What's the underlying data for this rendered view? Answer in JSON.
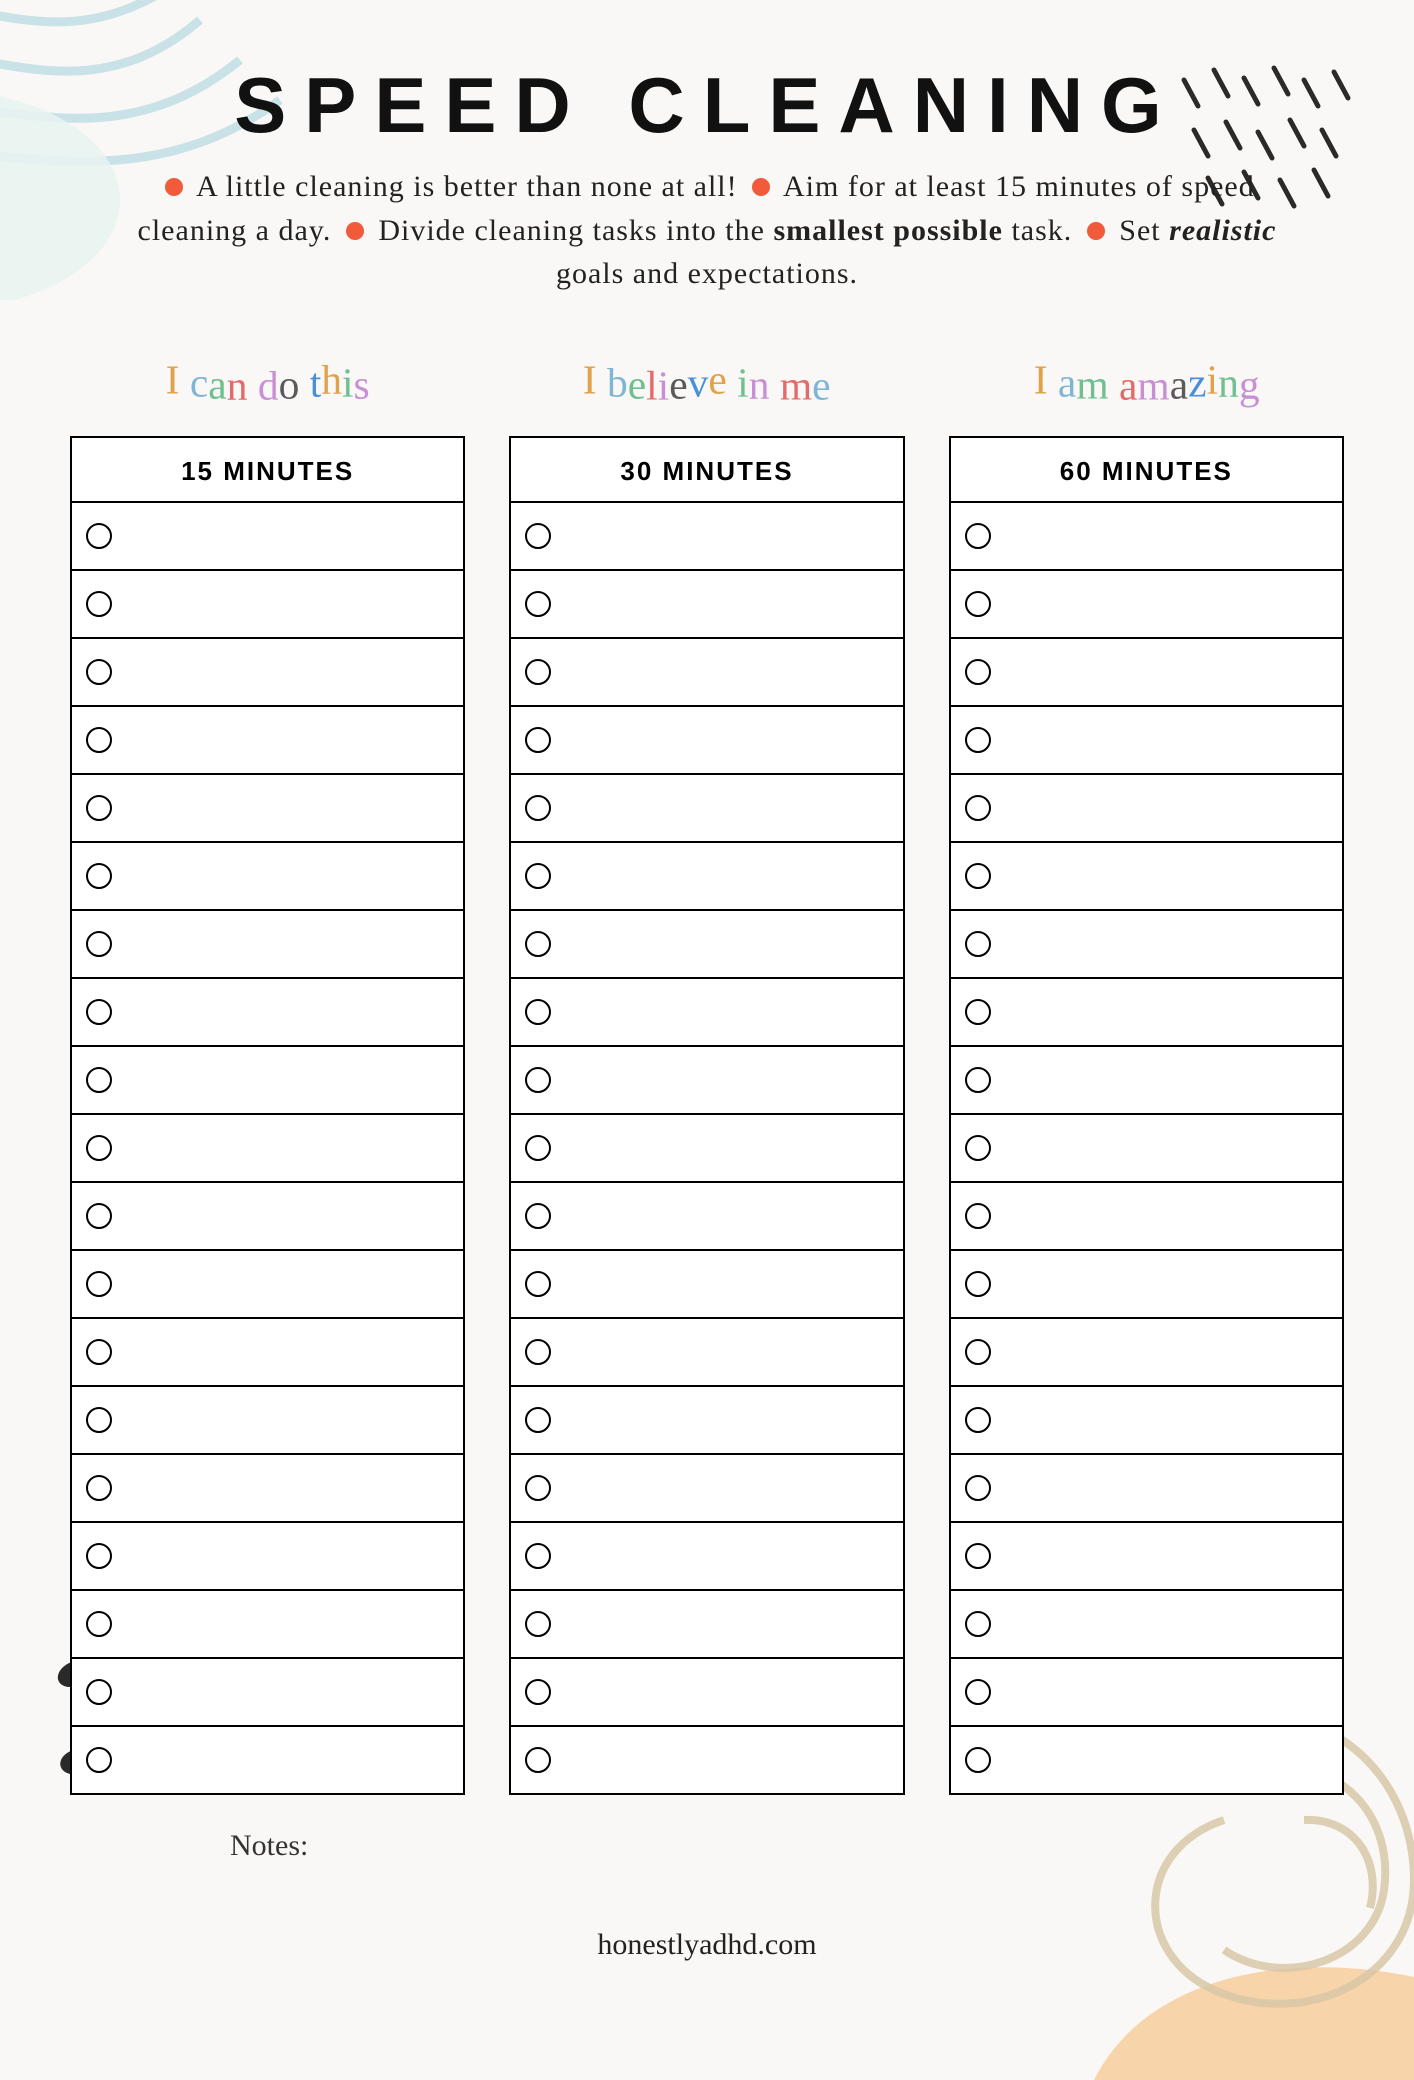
{
  "title": "SPEED CLEANING",
  "intro": {
    "t1": "A little cleaning is better than none at all!",
    "t2": "Aim for at least 15 minutes of speed cleaning a day.",
    "t3": "Divide cleaning tasks into the ",
    "t3b": "smallest possible",
    "t3c": " task.",
    "t4a": "Set ",
    "t4i": "realistic",
    "t4b": " goals and expectations."
  },
  "columns": [
    {
      "affirmation": "I can do this",
      "header": "15 MINUTES",
      "rows": 19
    },
    {
      "affirmation": "I believe in me",
      "header": "30 MINUTES",
      "rows": 19
    },
    {
      "affirmation": "I am amazing",
      "header": "60 MINUTES",
      "rows": 19
    }
  ],
  "palette": [
    "#e0a24a",
    "#7fb6d6",
    "#6fbf8f",
    "#e26a6a",
    "#c98fd6",
    "#5a5a5a",
    "#4a90d9",
    "#e0a24a",
    "#6fbf8f",
    "#c98fd6",
    "#e26a6a",
    "#7fb6d6",
    "#5a5a5a",
    "#4a90d9",
    "#e0a24a",
    "#6fbf8f"
  ],
  "notes_label": "Notes:",
  "footer": "honestlyadhd.com"
}
